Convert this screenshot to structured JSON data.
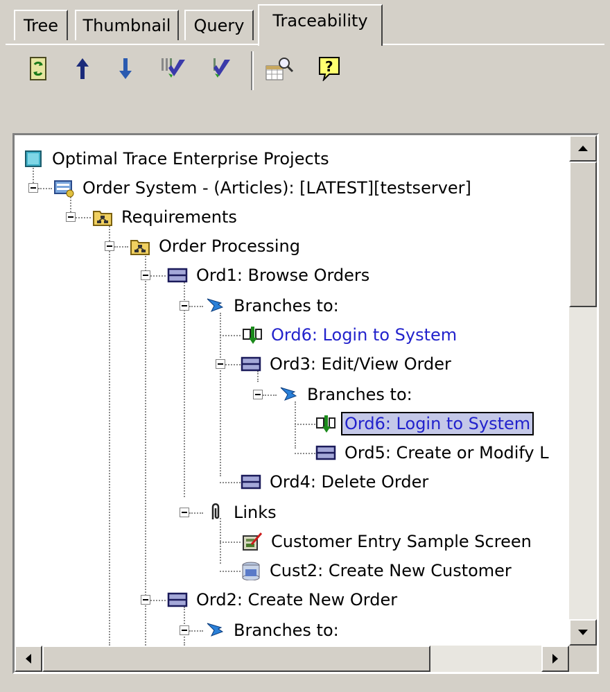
{
  "tabs": [
    {
      "label": "Tree"
    },
    {
      "label": "Thumbnail"
    },
    {
      "label": "Query"
    },
    {
      "label": "Traceability",
      "active": true
    }
  ],
  "toolbar": {
    "buttons": [
      {
        "icon": "refresh-icon"
      },
      {
        "icon": "arrow-up-icon"
      },
      {
        "icon": "arrow-down-icon"
      },
      {
        "icon": "check-all-icon"
      },
      {
        "icon": "check-icon"
      },
      {
        "icon": "find-icon"
      },
      {
        "icon": "help-icon"
      }
    ]
  },
  "tree": {
    "items": [
      {
        "label": "Optimal Trace Enterprise Projects",
        "icon": "root-icon"
      },
      {
        "label": "Order System - (Articles): [LATEST][testserver]",
        "icon": "project-server-icon"
      },
      {
        "label": "Requirements",
        "icon": "folder-hierarchy-icon"
      },
      {
        "label": "Order Processing",
        "icon": "folder-hierarchy-icon"
      },
      {
        "label": "Ord1: Browse Orders",
        "icon": "requirement-icon"
      },
      {
        "label": "Branches to:",
        "icon": "branch-arrow-icon"
      },
      {
        "label": "Ord6: Login to System",
        "icon": "linked-requirement-icon",
        "link": true
      },
      {
        "label": "Ord3: Edit/View Order",
        "icon": "requirement-icon"
      },
      {
        "label": "Branches to:",
        "icon": "branch-arrow-icon"
      },
      {
        "label": "Ord6: Login to System",
        "icon": "linked-requirement-icon",
        "link": true,
        "selected": true
      },
      {
        "label": "Ord5: Create or Modify L",
        "icon": "requirement-icon"
      },
      {
        "label": "Ord4: Delete Order",
        "icon": "requirement-icon"
      },
      {
        "label": "Links",
        "icon": "paperclip-icon"
      },
      {
        "label": "Customer Entry Sample Screen",
        "icon": "screen-document-icon"
      },
      {
        "label": "Cust2: Create New Customer",
        "icon": "database-link-icon"
      },
      {
        "label": "Ord2: Create New Order",
        "icon": "requirement-icon"
      },
      {
        "label": "Branches to:",
        "icon": "branch-arrow-icon"
      }
    ]
  },
  "colors": {
    "chrome": "#d4d0c8",
    "link": "#2222cc",
    "selection": "#c4c8e8"
  }
}
